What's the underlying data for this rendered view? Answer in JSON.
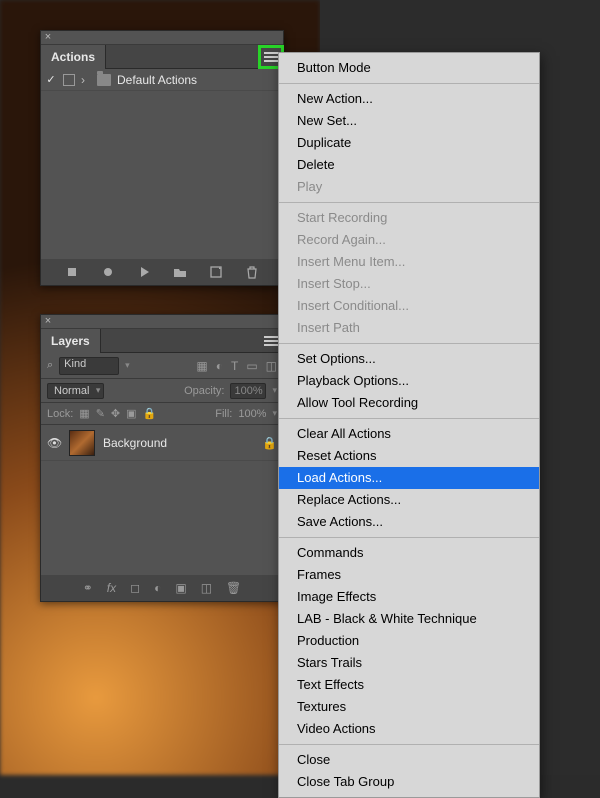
{
  "actions_panel": {
    "tab_label": "Actions",
    "row": {
      "checked": "✓",
      "name": "Default Actions"
    },
    "footer_icons": [
      "stop-icon",
      "record-icon",
      "play-icon",
      "folder-icon",
      "new-icon",
      "trash-icon"
    ]
  },
  "layers_panel": {
    "tab_label": "Layers",
    "search_placeholder": "Kind",
    "blend_label": "Normal",
    "opacity_label": "Opacity:",
    "opacity_value": "100%",
    "lock_label": "Lock:",
    "fill_label": "Fill:",
    "fill_value": "100%",
    "layer": {
      "name": "Background"
    }
  },
  "menu": {
    "groups": [
      {
        "items": [
          {
            "label": "Button Mode",
            "disabled": false
          }
        ]
      },
      {
        "items": [
          {
            "label": "New Action...",
            "disabled": false
          },
          {
            "label": "New Set...",
            "disabled": false
          },
          {
            "label": "Duplicate",
            "disabled": false
          },
          {
            "label": "Delete",
            "disabled": false
          },
          {
            "label": "Play",
            "disabled": true
          }
        ]
      },
      {
        "items": [
          {
            "label": "Start Recording",
            "disabled": true
          },
          {
            "label": "Record Again...",
            "disabled": true
          },
          {
            "label": "Insert Menu Item...",
            "disabled": true
          },
          {
            "label": "Insert Stop...",
            "disabled": true
          },
          {
            "label": "Insert Conditional...",
            "disabled": true
          },
          {
            "label": "Insert Path",
            "disabled": true
          }
        ]
      },
      {
        "items": [
          {
            "label": "Set Options...",
            "disabled": false
          },
          {
            "label": "Playback Options...",
            "disabled": false
          },
          {
            "label": "Allow Tool Recording",
            "disabled": false
          }
        ]
      },
      {
        "items": [
          {
            "label": "Clear All Actions",
            "disabled": false
          },
          {
            "label": "Reset Actions",
            "disabled": false
          },
          {
            "label": "Load Actions...",
            "disabled": false,
            "selected": true
          },
          {
            "label": "Replace Actions...",
            "disabled": false
          },
          {
            "label": "Save Actions...",
            "disabled": false
          }
        ]
      },
      {
        "items": [
          {
            "label": "Commands",
            "disabled": false
          },
          {
            "label": "Frames",
            "disabled": false
          },
          {
            "label": "Image Effects",
            "disabled": false
          },
          {
            "label": "LAB - Black & White Technique",
            "disabled": false
          },
          {
            "label": "Production",
            "disabled": false
          },
          {
            "label": "Stars Trails",
            "disabled": false
          },
          {
            "label": "Text Effects",
            "disabled": false
          },
          {
            "label": "Textures",
            "disabled": false
          },
          {
            "label": "Video Actions",
            "disabled": false
          }
        ]
      },
      {
        "items": [
          {
            "label": "Close",
            "disabled": false
          },
          {
            "label": "Close Tab Group",
            "disabled": false
          }
        ]
      }
    ]
  },
  "colors": {
    "highlight_green": "#28d428",
    "menu_highlight": "#1a6fe8"
  }
}
